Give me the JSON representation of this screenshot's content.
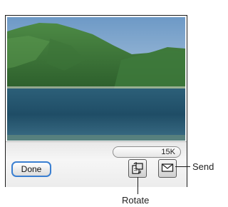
{
  "toolbar": {
    "done_label": "Done",
    "file_size": "15K",
    "rotate_icon": "rotate-icon",
    "send_icon": "envelope-icon"
  },
  "callouts": {
    "send": "Send",
    "rotate": "Rotate"
  },
  "colors": {
    "done_border": "#3a7fd1",
    "toolbar_bg": "#efefef"
  }
}
